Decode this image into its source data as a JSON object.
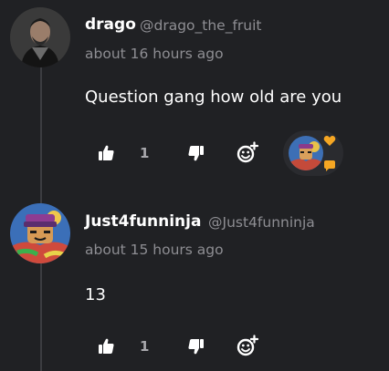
{
  "comments": [
    {
      "username": "drago",
      "handle": "@drago_the_fruit",
      "timestamp": "about 16 hours ago",
      "body": "Question gang how old are you",
      "likes": "1",
      "has_reaction": true
    },
    {
      "username": "Just4funninja",
      "handle": "@Just4funninja",
      "timestamp": "about 15 hours ago",
      "body": "13",
      "likes": "1",
      "has_reaction": false
    }
  ],
  "colors": {
    "background": "#202124",
    "text_primary": "#ffffff",
    "text_secondary": "#8e8e93",
    "heart": "#f5a623",
    "bubble": "#f5a623"
  },
  "icons": {
    "like": "thumbs-up-icon",
    "dislike": "thumbs-down-icon",
    "react": "add-reaction-icon"
  }
}
